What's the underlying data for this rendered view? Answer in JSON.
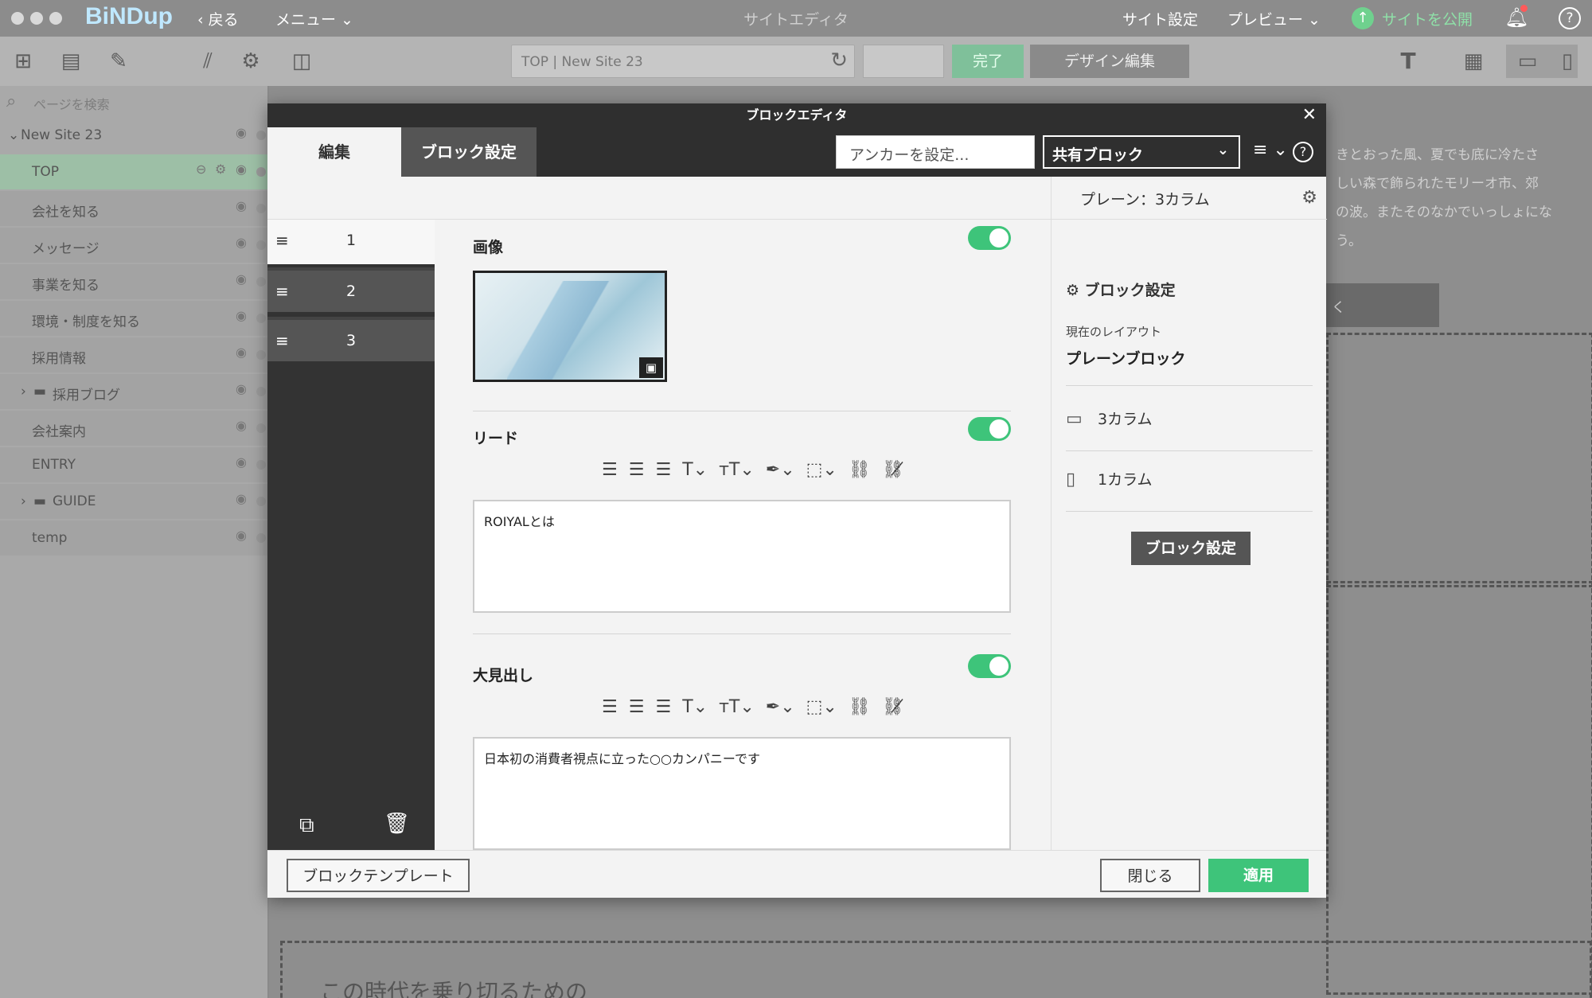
{
  "app": {
    "logo": "BiNDup",
    "back_label": "戻る",
    "menu_label": "メニュー ⌄",
    "window_title": "サイトエディタ",
    "site_settings": "サイト設定",
    "preview": "プレビュー ⌄",
    "publish": "サイトを公開"
  },
  "toolbar": {
    "url_text": "TOP | New Site 23",
    "done_label": "完了",
    "design_edit_label": "デザイン編集"
  },
  "sidebar": {
    "search_placeholder": "ページを検索",
    "root": "New Site 23",
    "pages": [
      {
        "label": "TOP"
      },
      {
        "label": "会社を知る"
      },
      {
        "label": "メッセージ"
      },
      {
        "label": "事業を知る"
      },
      {
        "label": "環境・制度を知る"
      },
      {
        "label": "採用情報"
      },
      {
        "label": "採用ブログ"
      },
      {
        "label": "会社案内"
      },
      {
        "label": "ENTRY"
      },
      {
        "label": "GUIDE"
      },
      {
        "label": "temp"
      }
    ]
  },
  "background": {
    "line1": "きとおった風、夏でも底に冷たさ",
    "line2": "しい森で飾られたモリーオ市、郊",
    "line3": "の波。またそのなかでいっしょにな",
    "line4": "う。",
    "button": "く",
    "heading": "この時代を乗り切るための"
  },
  "modal": {
    "title": "ブロックエディタ",
    "tab_edit": "編集",
    "tab_block_settings": "ブロック設定",
    "anchor_placeholder": "アンカーを設定...",
    "shared_block": "共有ブロック",
    "blocks": [
      "1",
      "2",
      "3"
    ],
    "sections": {
      "image_label": "画像",
      "lead_label": "リード",
      "lead_text": "ROIYALとは",
      "heading_label": "大見出し",
      "heading_text": "日本初の消費者視点に立った○○カンパニーです"
    },
    "right_panel": {
      "header": "プレーン：3カラム",
      "section_title": "ブロック設定",
      "current_layout_label": "現在のレイアウト",
      "current_layout": "プレーンブロック",
      "option_desktop": "3カラム",
      "option_mobile": "1カラム",
      "button": "ブロック設定"
    },
    "footer": {
      "template_button": "ブロックテンプレート",
      "close_button": "閉じる",
      "apply_button": "適用"
    }
  },
  "colors": {
    "accent_green": "#3ec47a",
    "dark": "#2f2f2f"
  }
}
